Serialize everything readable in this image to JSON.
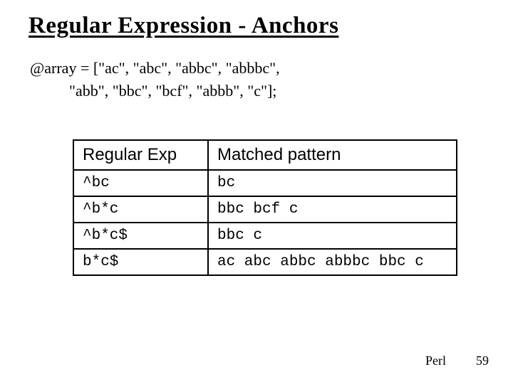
{
  "title": "Regular Expression - Anchors",
  "code": {
    "line1": "@array = [\"ac\", \"abc\", \"abbc\", \"abbbc\",",
    "line2": "          \"abb\", \"bbc\", \"bcf\", \"abbb\", \"c\"];"
  },
  "table": {
    "headers": {
      "regex": "Regular Exp",
      "matched": "Matched pattern"
    },
    "rows": [
      {
        "regex": "^bc",
        "matched": "bc"
      },
      {
        "regex": "^b*c",
        "matched": "bbc bcf c"
      },
      {
        "regex": "^b*c$",
        "matched": "bbc c"
      },
      {
        "regex": " b*c$",
        "matched": "ac abc abbc abbbc bbc c"
      }
    ]
  },
  "footer": {
    "label": "Perl",
    "page": "59"
  }
}
